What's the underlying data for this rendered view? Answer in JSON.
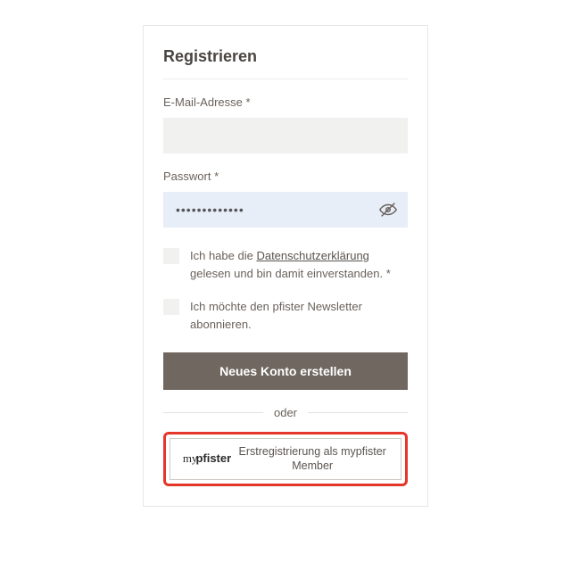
{
  "title": "Registrieren",
  "email": {
    "label": "E-Mail-Adresse *",
    "value": ""
  },
  "password": {
    "label": "Passwort *",
    "value": "•••••••••••••"
  },
  "privacy": {
    "prefix": "Ich habe die ",
    "link": "Datenschutzerklärung",
    "suffix": " gelesen und bin damit einverstanden. *"
  },
  "newsletter": {
    "text": "Ich möchte den pfister Newsletter abonnieren."
  },
  "submit_label": "Neues Konto erstellen",
  "divider_label": "oder",
  "secondary": {
    "logo_my": "my",
    "logo_pfister": "pfister",
    "label": "Erstregistrierung als mypfister Member"
  }
}
